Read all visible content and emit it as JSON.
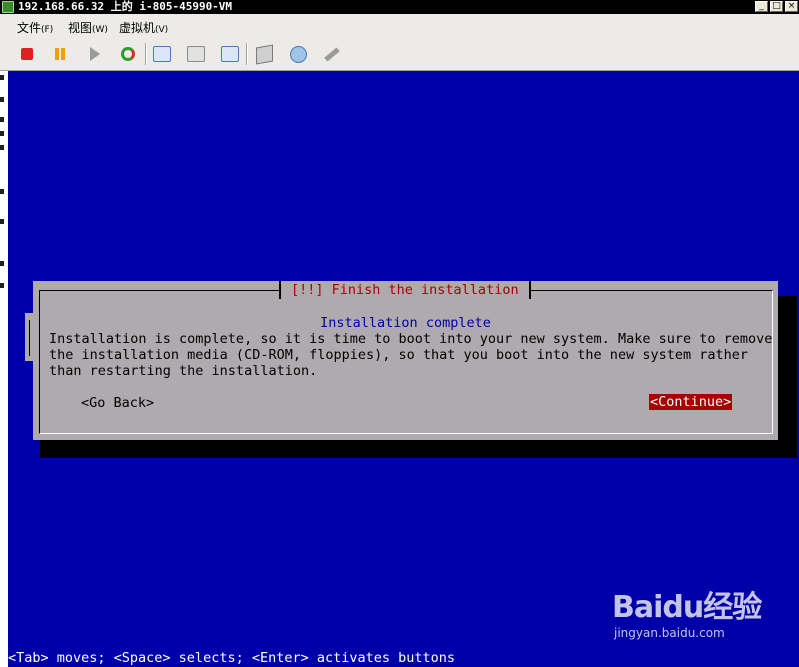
{
  "window": {
    "title": "192.168.66.32 上的 i-805-45990-VM",
    "controls": {
      "minimize": "_",
      "maximize": "□",
      "close": "×"
    }
  },
  "menu": [
    {
      "label": "文件",
      "hotkey": "(F)"
    },
    {
      "label": "视图",
      "hotkey": "(W)"
    },
    {
      "label": "虚拟机",
      "hotkey": "(V)"
    }
  ],
  "toolbar": {
    "buttons": [
      "stop-icon",
      "pause-icon",
      "play-icon",
      "reset-icon",
      "snapshot-icon",
      "revert-snapshot-icon",
      "manage-snapshots-icon",
      "settings-icon",
      "cd-dvd-icon",
      "vm-tools-icon"
    ]
  },
  "dialog": {
    "title": "[!!] Finish the installation",
    "heading": "Installation complete",
    "body_lines": [
      "Installation is complete, so it is time to boot into your new system. Make sure to remove",
      "the installation media (CD-ROM, floppies), so that you boot into the new system rather",
      "than restarting the installation."
    ],
    "back_label": "<Go Back>",
    "continue_label": "<Continue>"
  },
  "hint": "<Tab> moves; <Space> selects; <Enter> activates buttons",
  "watermark": {
    "logo": "Baidu经验",
    "url": "jingyan.baidu.com"
  },
  "colors": {
    "console_bg": "#0000a8",
    "dialog_bg": "#aeaaae",
    "title_red": "#a80000",
    "heading_blue": "#0000a8"
  }
}
